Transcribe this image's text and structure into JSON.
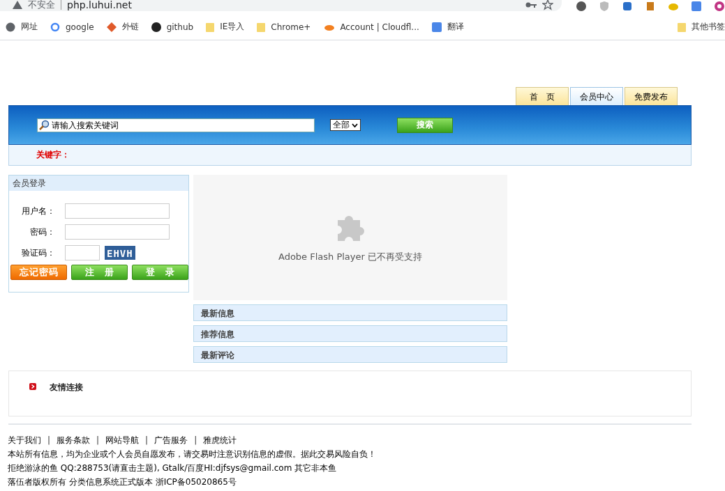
{
  "browser": {
    "security": "不安全",
    "url": "php.luhui.net",
    "bookmarks": [
      "网址",
      "google",
      "外链",
      "github",
      "IE导入",
      "Chrome+",
      "Account | Cloudfl...",
      "翻译"
    ],
    "other_bookmarks": "其他书签"
  },
  "tabs": [
    {
      "label": "首　页",
      "selected": false
    },
    {
      "label": "会员中心",
      "selected": true
    },
    {
      "label": "免费发布",
      "selected": false
    }
  ],
  "search": {
    "placeholder": "请输入搜索关键词",
    "scope": "全部",
    "button": "搜索",
    "keyword_label": "关键字："
  },
  "login": {
    "title": "会员登录",
    "fields": [
      {
        "label": "用户名：",
        "kind": "text"
      },
      {
        "label": "密码：",
        "kind": "password"
      },
      {
        "label": "验证码：",
        "kind": "captcha",
        "captcha": "EHVH"
      }
    ],
    "buttons": [
      {
        "label": "忘记密码",
        "kind": "orange"
      },
      {
        "label": "注　册",
        "kind": "green"
      },
      {
        "label": "登　录",
        "kind": "green"
      }
    ]
  },
  "flash": {
    "message": "Adobe Flash Player 已不再受支持"
  },
  "sections": [
    "最新信息",
    "推荐信息",
    "最新评论"
  ],
  "friend_links": {
    "title": "友情连接"
  },
  "footer": {
    "nav": [
      {
        "kind": "link",
        "text": "关于我们"
      },
      {
        "kind": "separator",
        "text": "|"
      },
      {
        "kind": "link",
        "text": "服务条款"
      },
      {
        "kind": "separator",
        "text": "|"
      },
      {
        "kind": "link",
        "text": "网站导航"
      },
      {
        "kind": "separator",
        "text": "|"
      },
      {
        "kind": "link",
        "text": "广告服务"
      },
      {
        "kind": "separator",
        "text": "|"
      },
      {
        "kind": "link",
        "text": "雅虎统计"
      }
    ],
    "lines": [
      "本站所有信息，均为企业或个人会员自愿发布，请交易时注意识别信息的虚假。据此交易风险自负！",
      "拒绝游泳的鱼 QQ:288753(请直击主题), Gtalk/百度HI:djfsys@gmail.com 其它非本鱼",
      "落伍者版权所有 分类信息系统正式版本 浙ICP备05020865号"
    ]
  }
}
